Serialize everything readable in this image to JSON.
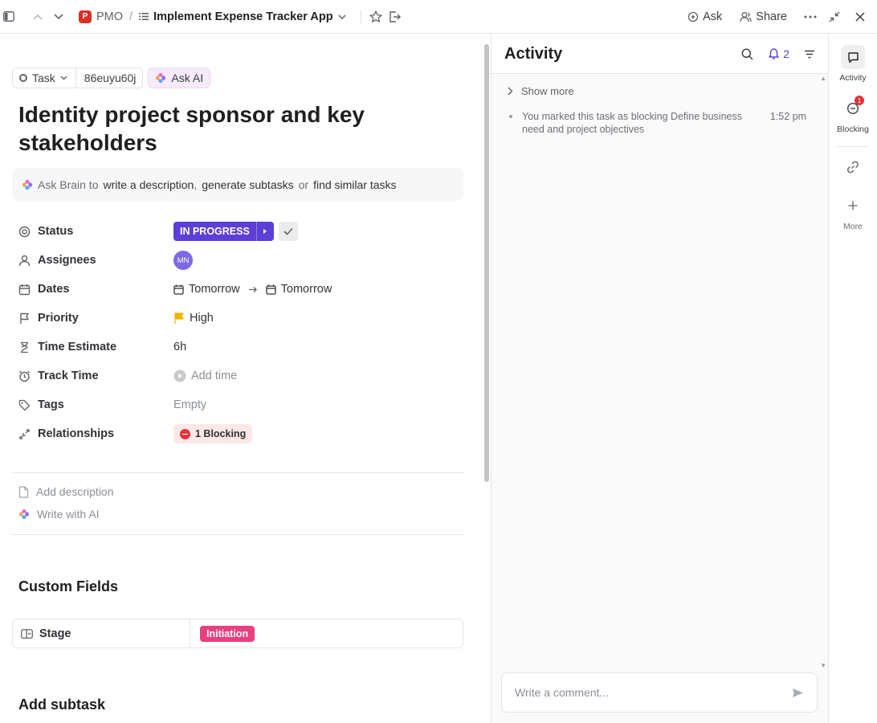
{
  "topbar": {
    "space_badge": "P",
    "space_name": "PMO",
    "separator": "/",
    "list_title": "Implement Expense Tracker App",
    "ask_label": "Ask",
    "share_label": "Share"
  },
  "task": {
    "type_label": "Task",
    "task_id": "86euyu60j",
    "ask_ai_label": "Ask AI",
    "title": "Identity project sponsor and key stakeholders"
  },
  "brain": {
    "prefix": "Ask Brain to",
    "opt1": "write a description",
    "sep1": ",",
    "opt2": "generate subtasks",
    "sep2": "or",
    "opt3": "find similar tasks"
  },
  "fields": {
    "status_label": "Status",
    "status_value": "IN PROGRESS",
    "assignees_label": "Assignees",
    "assignee_initials": "MN",
    "dates_label": "Dates",
    "start_date": "Tomorrow",
    "due_date": "Tomorrow",
    "priority_label": "Priority",
    "priority_value": "High",
    "estimate_label": "Time Estimate",
    "estimate_value": "6h",
    "track_label": "Track Time",
    "track_value": "Add time",
    "tags_label": "Tags",
    "tags_value": "Empty",
    "relationships_label": "Relationships",
    "relationships_value": "1 Blocking"
  },
  "description": {
    "add_label": "Add description",
    "ai_label": "Write with AI"
  },
  "custom_fields": {
    "heading": "Custom Fields",
    "stage_label": "Stage",
    "stage_value": "Initiation"
  },
  "subtasks": {
    "heading": "Add subtask"
  },
  "activity": {
    "title": "Activity",
    "notification_count": "2",
    "show_more": "Show more",
    "event_text": "You marked this task as blocking Define business need and project objectives",
    "event_time": "1:52 pm",
    "comment_placeholder": "Write a comment..."
  },
  "rail": {
    "activity_label": "Activity",
    "blocking_label": "Blocking",
    "blocking_badge": "1",
    "more_label": "More"
  },
  "colors": {
    "status": "#5b3fd6",
    "priority_flag": "#f5b400",
    "stage": "#ea3f80",
    "blocking": "#e0343a"
  }
}
